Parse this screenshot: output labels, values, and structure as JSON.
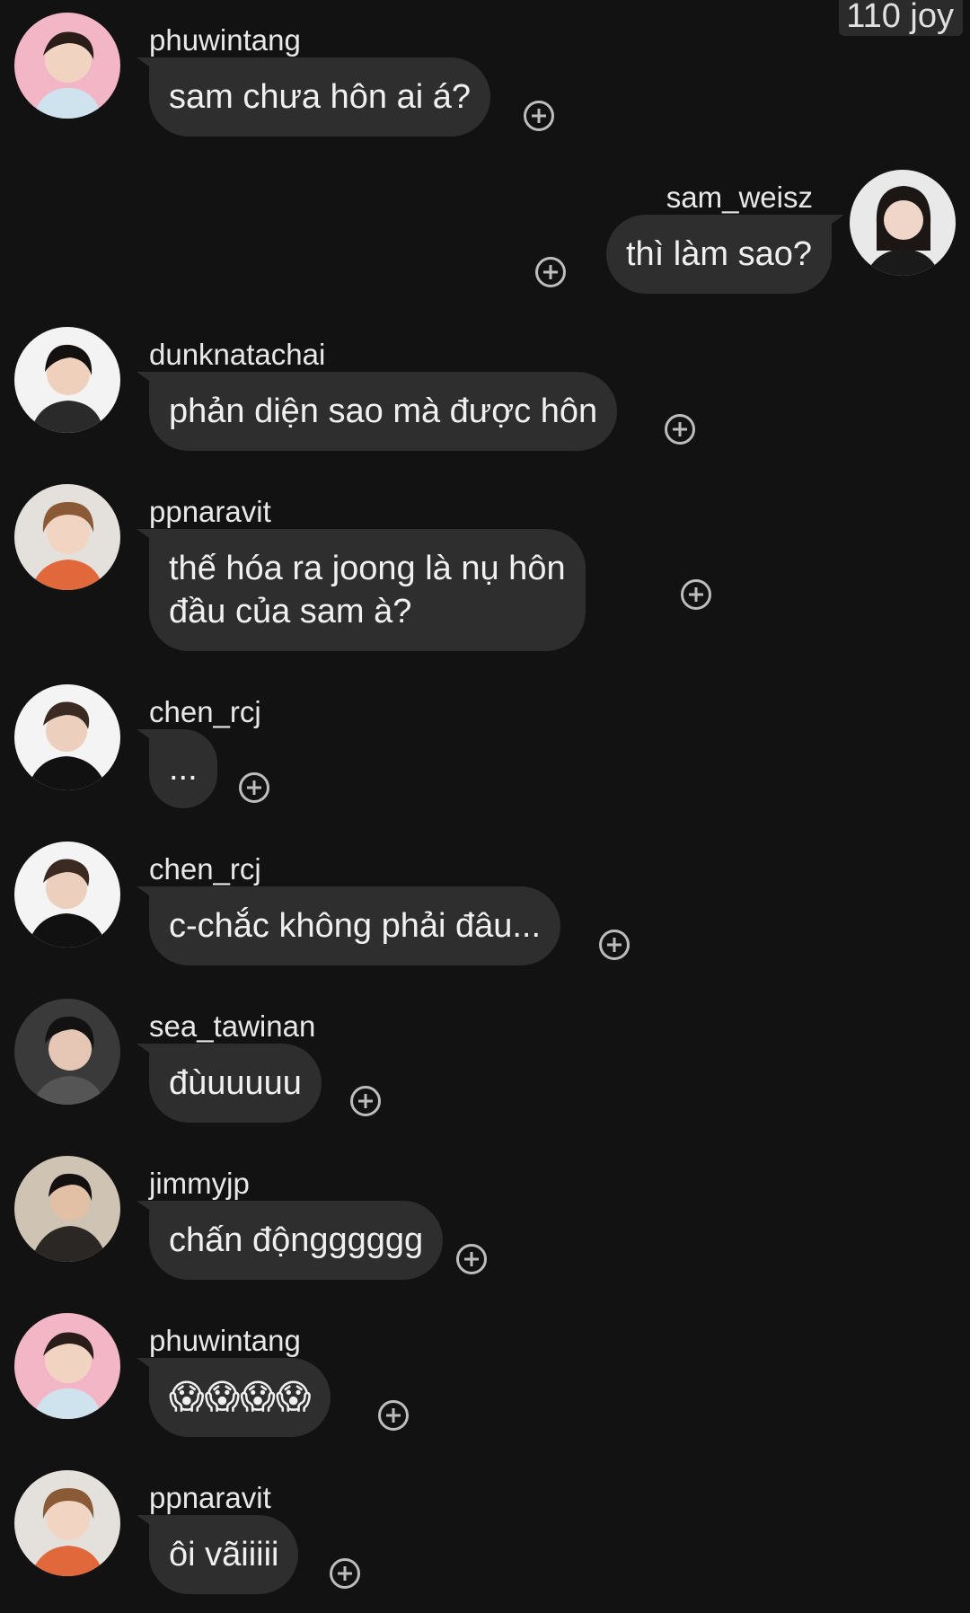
{
  "header": {
    "badge": "110 joy"
  },
  "messages": [
    {
      "user": "phuwintang",
      "text": "sam chưa hôn ai á?",
      "side": "left"
    },
    {
      "user": "sam_weisz",
      "text": "thì làm sao?",
      "side": "right"
    },
    {
      "user": "dunknatachai",
      "text": "phản diện sao mà được hôn",
      "side": "left"
    },
    {
      "user": "ppnaravit",
      "text": "thế hóa ra joong là nụ hôn\nđầu của sam à?",
      "side": "left"
    },
    {
      "user": "chen_rcj",
      "text": "...",
      "side": "left"
    },
    {
      "user": "chen_rcj",
      "text": "c-chắc không phải đâu...",
      "side": "left"
    },
    {
      "user": "sea_tawinan",
      "text": "đùuuuuu",
      "side": "left"
    },
    {
      "user": "jimmyjp",
      "text": "chấn độngggggg",
      "side": "left"
    },
    {
      "user": "phuwintang",
      "text": "😱😱😱😱",
      "side": "left"
    },
    {
      "user": "ppnaravit",
      "text": "ôi vãiiiii",
      "side": "left"
    }
  ],
  "colors": {
    "background": "#121212",
    "bubble": "#2e2e2e",
    "text": "#f0f0f0"
  },
  "icons": {
    "react": "add-reaction-icon",
    "avatar": "avatar-portrait"
  }
}
